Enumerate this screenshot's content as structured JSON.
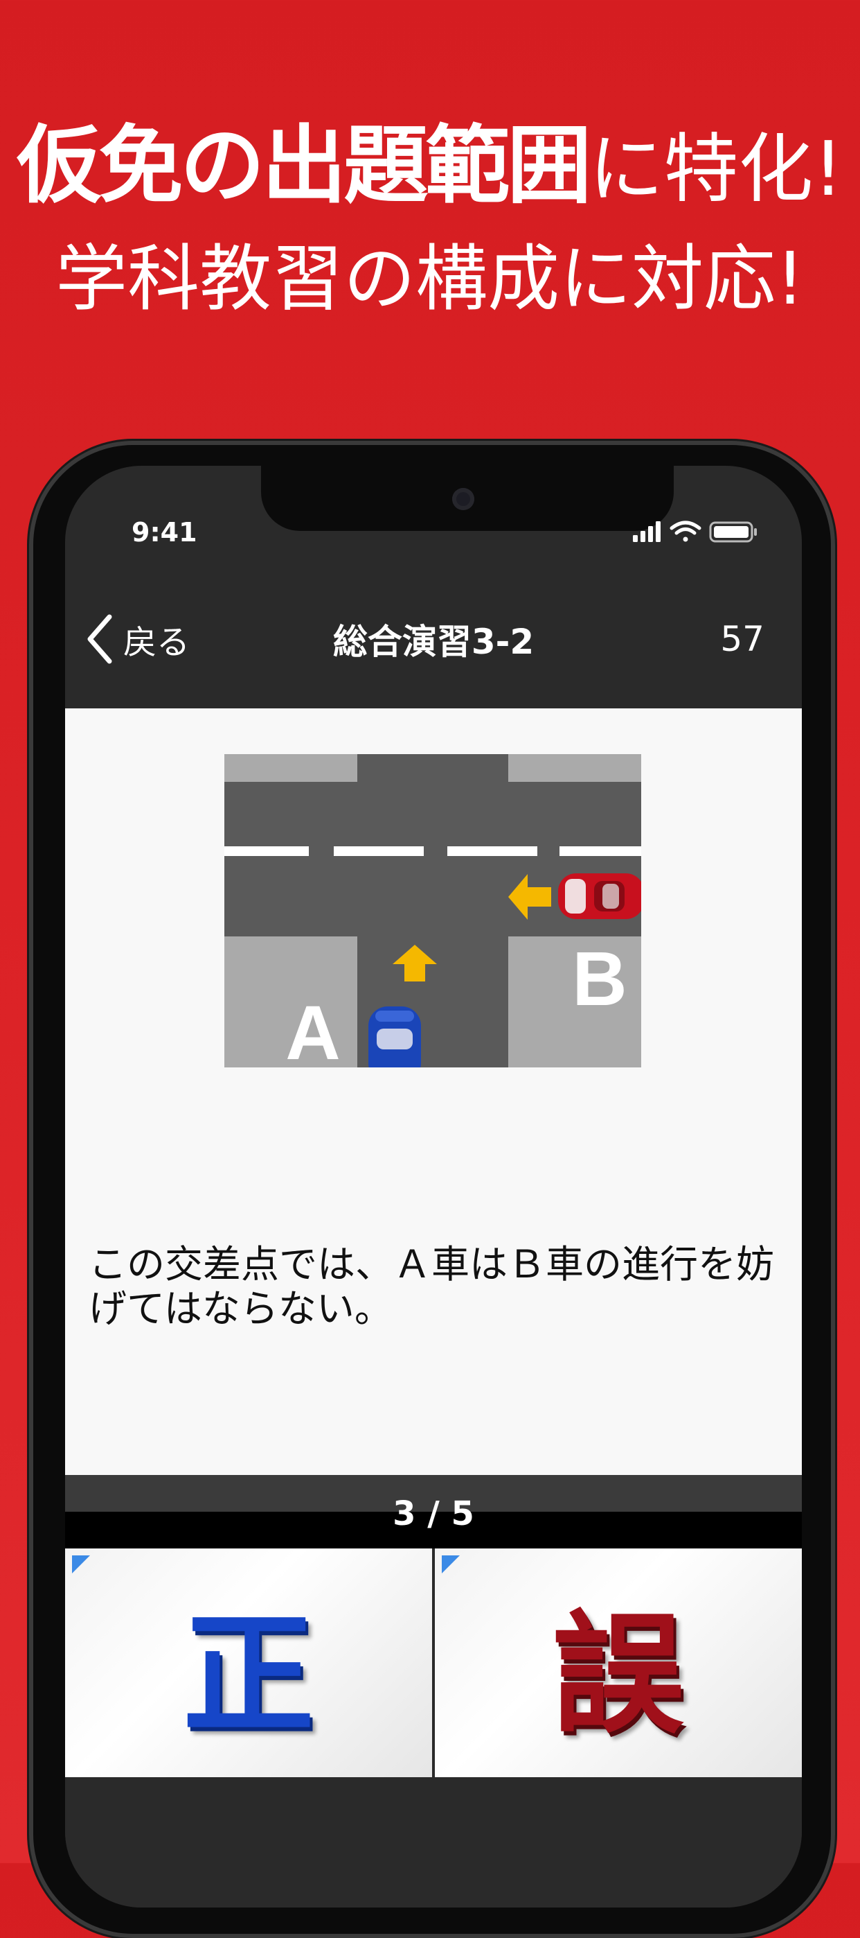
{
  "promo": {
    "line1_bold": "仮免の出題範囲",
    "line1_rest": "に特化!",
    "line2": "学科教習の構成に対応!"
  },
  "status_bar": {
    "time": "9:41"
  },
  "nav": {
    "back_label": "戻る",
    "title": "総合演習3-2",
    "count": "57"
  },
  "question": {
    "diagram_labels": {
      "car_a": "A",
      "car_b": "B"
    },
    "text": "この交差点では、Ａ車はＢ車の進行を妨げてはならない。"
  },
  "progress": {
    "text": "3 / 5"
  },
  "answers": {
    "true_label": "正",
    "false_label": "誤"
  },
  "colors": {
    "background": "#d51d21",
    "arrow": "#f5b800",
    "car_a": "#1a45b8",
    "car_b": "#c8101e"
  }
}
